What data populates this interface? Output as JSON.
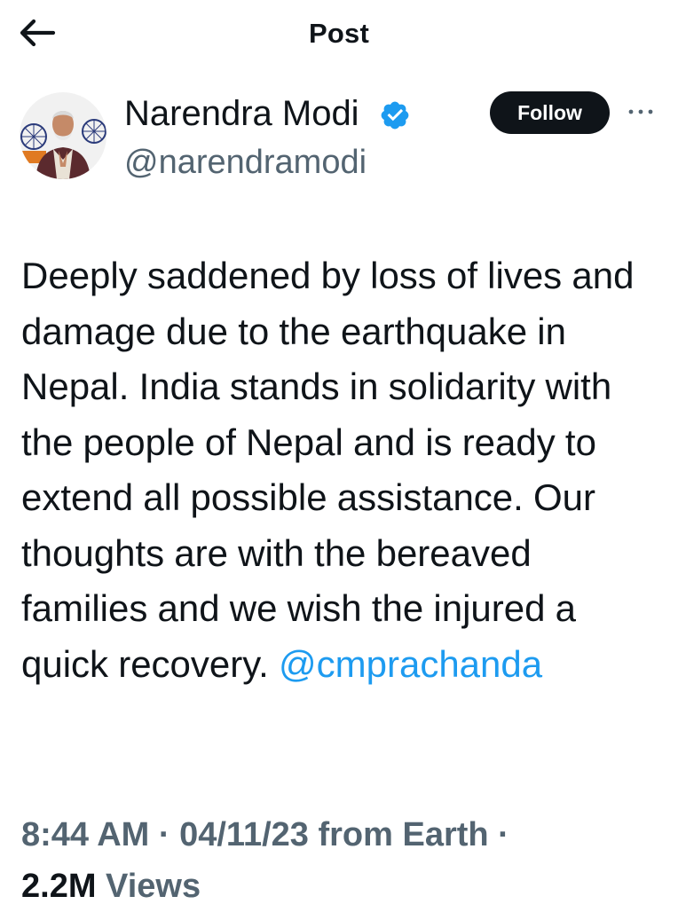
{
  "header": {
    "title": "Post",
    "back_icon": "arrow-left-icon"
  },
  "author": {
    "name": "Narendra Modi",
    "handle": "@narendramodi",
    "verified_icon": "verified-badge-icon",
    "verified_color": "#1d9bf0",
    "avatar_icon": "profile-photo"
  },
  "actions": {
    "follow_label": "Follow",
    "more_icon": "more-options-icon"
  },
  "post": {
    "text": "Deeply saddened by loss of lives and damage due to the earthquake in Nepal. India stands in solidarity with the people of Nepal and is ready to extend all possible assistance. Our thoughts are with the bereaved families and we wish the injured a quick recovery. ",
    "mention": "@cmprachanda",
    "mention_color": "#1d9bf0"
  },
  "meta": {
    "time": "8:44 AM",
    "sep1": " · ",
    "date": "04/11/23",
    "source": " from Earth",
    "sep2": " · ",
    "views_count": "2.2M",
    "views_label": " Views"
  },
  "colors": {
    "text_primary": "#0f1419",
    "text_secondary": "#536471",
    "button_bg": "#0f1419"
  }
}
